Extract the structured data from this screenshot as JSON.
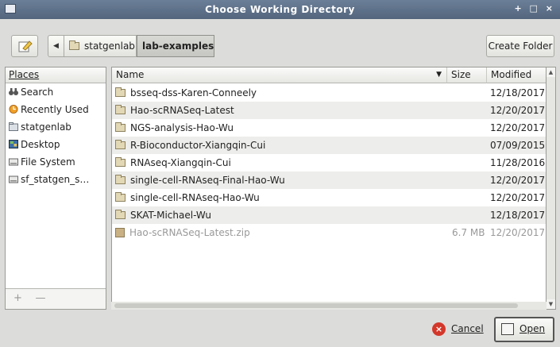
{
  "window": {
    "title": "Choose Working Directory",
    "controls": "+ □ ×"
  },
  "toolbar": {
    "back_glyph": "◀",
    "crumbs": [
      "statgenlab",
      "lab-examples"
    ],
    "create_folder_label": "Create Folder"
  },
  "places": {
    "header": "Places",
    "items": [
      {
        "label": "Search",
        "icon": "binoculars-icon"
      },
      {
        "label": "Recently Used",
        "icon": "clock-icon"
      },
      {
        "label": "statgenlab",
        "icon": "folder-icon"
      },
      {
        "label": "Desktop",
        "icon": "desktop-icon"
      },
      {
        "label": "File System",
        "icon": "drive-icon"
      },
      {
        "label": "sf_statgen_s…",
        "icon": "drive-icon"
      }
    ],
    "add_glyph": "+",
    "remove_glyph": "—"
  },
  "files": {
    "columns": {
      "name": "Name",
      "size": "Size",
      "modified": "Modified"
    },
    "sort_glyph": "▼",
    "rows": [
      {
        "name": "bsseq-dss-Karen-Conneely",
        "size": "",
        "modified": "12/18/2017"
      },
      {
        "name": "Hao-scRNASeq-Latest",
        "size": "",
        "modified": "12/20/2017"
      },
      {
        "name": "NGS-analysis-Hao-Wu",
        "size": "",
        "modified": "12/20/2017"
      },
      {
        "name": "R-Bioconductor-Xiangqin-Cui",
        "size": "",
        "modified": "07/09/2015"
      },
      {
        "name": "RNAseq-Xiangqin-Cui",
        "size": "",
        "modified": "11/28/2016"
      },
      {
        "name": "single-cell-RNAseq-Final-Hao-Wu",
        "size": "",
        "modified": "12/20/2017"
      },
      {
        "name": "single-cell-RNAseq-Hao-Wu",
        "size": "",
        "modified": "12/20/2017"
      },
      {
        "name": "SKAT-Michael-Wu",
        "size": "",
        "modified": "12/18/2017"
      },
      {
        "name": "Hao-scRNASeq-Latest.zip",
        "size": "6.7 MB",
        "modified": "12/20/2017"
      }
    ]
  },
  "buttons": {
    "cancel": "Cancel",
    "open": "Open"
  }
}
